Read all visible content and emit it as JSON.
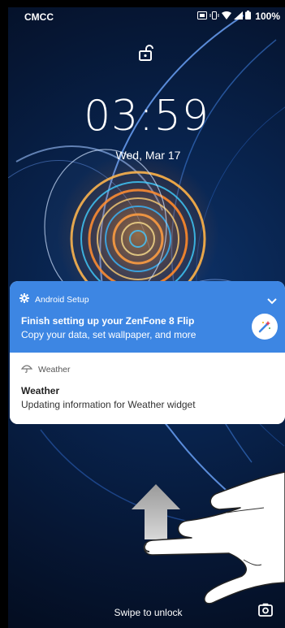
{
  "status_bar": {
    "carrier": "CMCC",
    "battery": "100%",
    "icons": [
      "sim-icon",
      "vibrate-icon",
      "wifi-icon",
      "signal-icon",
      "battery-icon"
    ]
  },
  "lockscreen": {
    "lock_icon": "unlocked-padlock-icon",
    "time": "03:59",
    "date": "Wed, Mar 17"
  },
  "notifications": [
    {
      "app": "Android Setup",
      "icon": "gear-icon",
      "title": "Finish setting up your ZenFone 8 Flip",
      "text": "Copy your data, set wallpaper, and more",
      "accent": "#3d86e3",
      "action_icon": "magic-wand-icon"
    },
    {
      "app": "Weather",
      "icon": "weather-icon",
      "title": "Weather",
      "text": "Updating information for Weather widget"
    }
  ],
  "bottom": {
    "hint": "Swipe to unlock",
    "camera_icon": "camera-icon"
  }
}
